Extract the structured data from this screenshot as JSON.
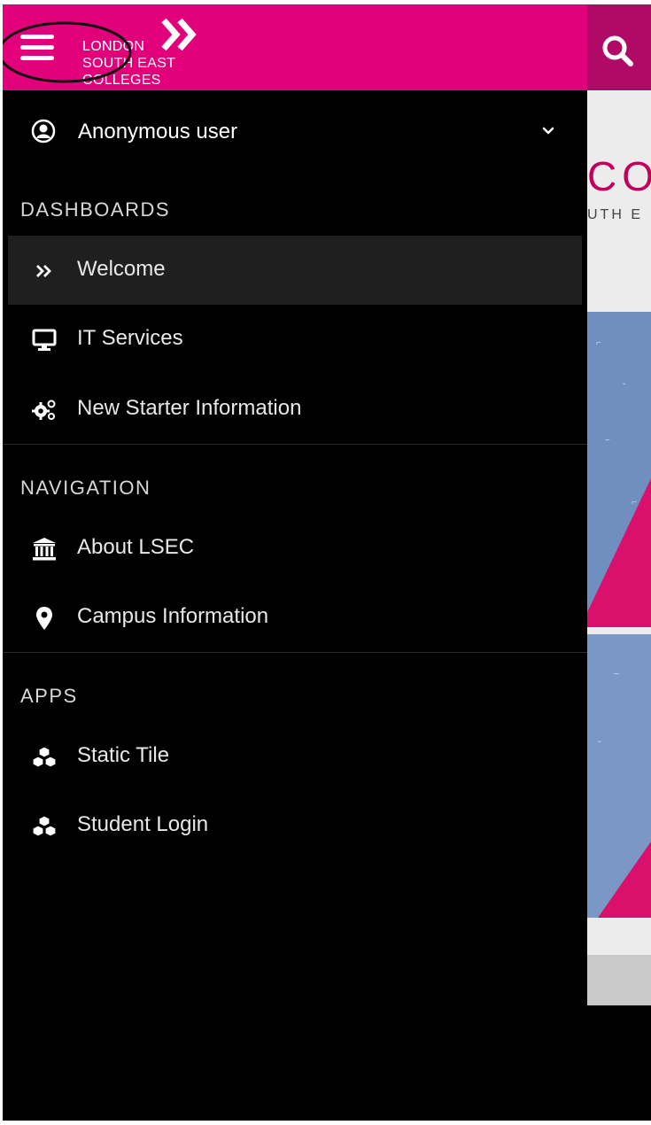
{
  "brand": {
    "logo_lines": [
      "LONDON",
      "SOUTH EAST",
      "COLLEGES"
    ],
    "color": "#e2007a"
  },
  "user": {
    "name": "Anonymous user"
  },
  "sections": [
    {
      "title": "DASHBOARDS",
      "items": [
        {
          "label": "Welcome",
          "icon": "double-chevron-right-icon",
          "active": true
        },
        {
          "label": "IT Services",
          "icon": "monitor-icon",
          "active": false
        },
        {
          "label": "New Starter Information",
          "icon": "cogs-icon",
          "active": false
        }
      ]
    },
    {
      "title": "NAVIGATION",
      "items": [
        {
          "label": "About LSEC",
          "icon": "institution-icon",
          "active": false
        },
        {
          "label": "Campus Information",
          "icon": "map-pin-icon",
          "active": false
        }
      ]
    },
    {
      "title": "APPS",
      "items": [
        {
          "label": "Static Tile",
          "icon": "cubes-icon",
          "active": false
        },
        {
          "label": "Student Login",
          "icon": "cubes-icon",
          "active": false
        }
      ]
    }
  ],
  "background_page": {
    "logo_fragment": "CO",
    "subtitle_fragment": "UTH E"
  }
}
